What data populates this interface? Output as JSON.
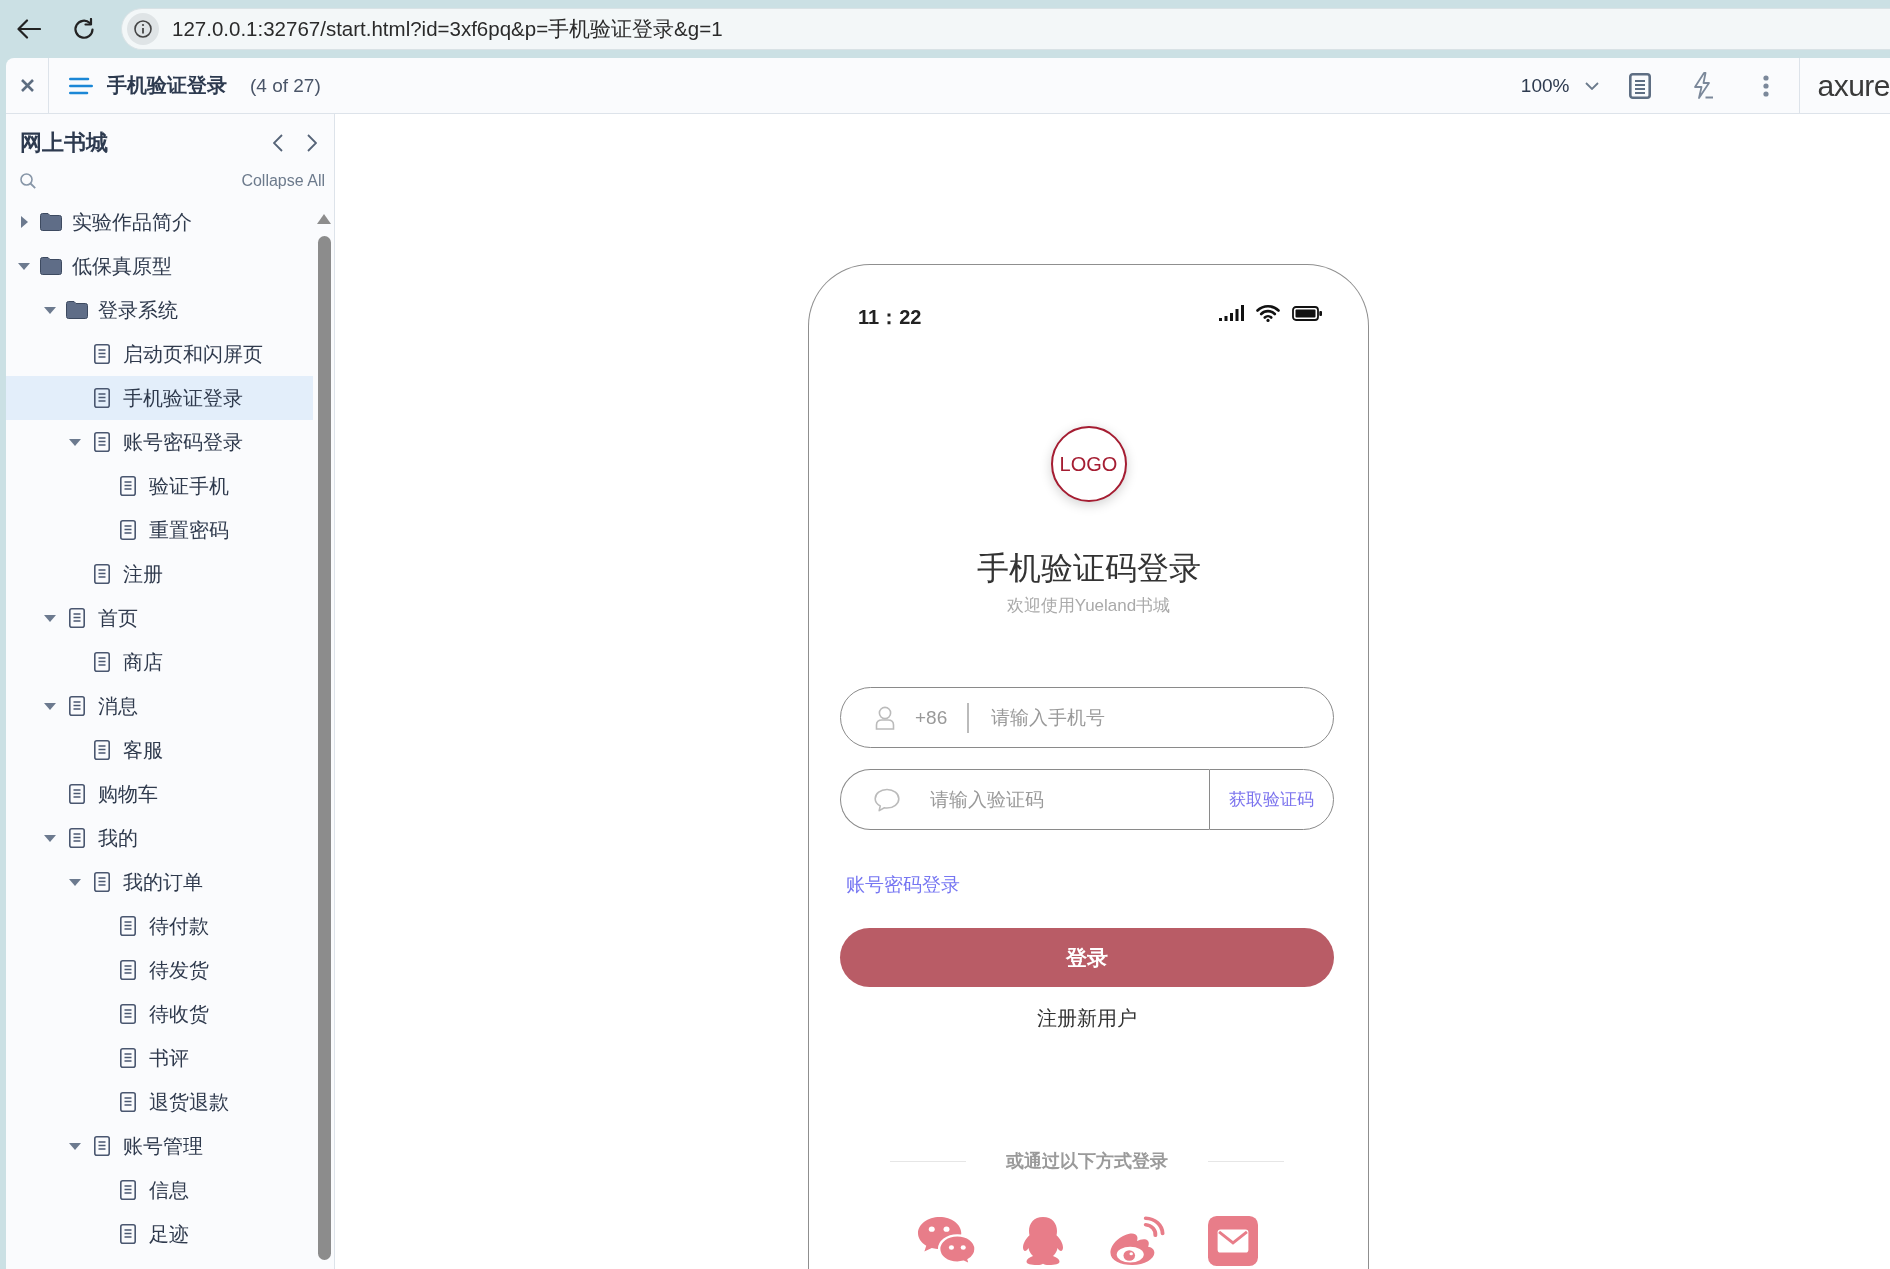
{
  "browser": {
    "url": "127.0.0.1:32767/start.html?id=3xf6pq&p=手机验证登录&g=1"
  },
  "toolbar": {
    "page_title": "手机验证登录",
    "page_position": "(4 of 27)",
    "zoom": "100%",
    "logo": "axure"
  },
  "sidebar": {
    "title": "网上书城",
    "collapse_all": "Collapse All",
    "pages": [
      {
        "label": "实验作品简介",
        "kind": "folder",
        "expanded": false,
        "selected": false
      },
      {
        "label": "低保真原型",
        "kind": "folder",
        "expanded": true,
        "selected": false,
        "children": [
          {
            "label": "登录系统",
            "kind": "folder",
            "expanded": true,
            "selected": false,
            "children": [
              {
                "label": "启动页和闪屏页",
                "kind": "page",
                "selected": false
              },
              {
                "label": "手机验证登录",
                "kind": "page",
                "selected": true
              },
              {
                "label": "账号密码登录",
                "kind": "page",
                "expanded": true,
                "selected": false,
                "children": [
                  {
                    "label": "验证手机",
                    "kind": "page",
                    "selected": false
                  },
                  {
                    "label": "重置密码",
                    "kind": "page",
                    "selected": false
                  }
                ]
              },
              {
                "label": "注册",
                "kind": "page",
                "selected": false
              }
            ]
          },
          {
            "label": "首页",
            "kind": "page",
            "expanded": true,
            "selected": false,
            "children": [
              {
                "label": "商店",
                "kind": "page",
                "selected": false
              }
            ]
          },
          {
            "label": "消息",
            "kind": "page",
            "expanded": true,
            "selected": false,
            "children": [
              {
                "label": "客服",
                "kind": "page",
                "selected": false
              }
            ]
          },
          {
            "label": "购物车",
            "kind": "page",
            "selected": false
          },
          {
            "label": "我的",
            "kind": "page",
            "expanded": true,
            "selected": false,
            "children": [
              {
                "label": "我的订单",
                "kind": "page",
                "expanded": true,
                "selected": false,
                "children": [
                  {
                    "label": "待付款",
                    "kind": "page",
                    "selected": false
                  },
                  {
                    "label": "待发货",
                    "kind": "page",
                    "selected": false
                  },
                  {
                    "label": "待收货",
                    "kind": "page",
                    "selected": false
                  },
                  {
                    "label": "书评",
                    "kind": "page",
                    "selected": false
                  },
                  {
                    "label": "退货退款",
                    "kind": "page",
                    "selected": false
                  }
                ]
              },
              {
                "label": "账号管理",
                "kind": "page",
                "expanded": true,
                "selected": false,
                "children": [
                  {
                    "label": "信息",
                    "kind": "page",
                    "selected": false
                  },
                  {
                    "label": "足迹",
                    "kind": "page",
                    "selected": false
                  }
                ]
              }
            ]
          }
        ]
      }
    ]
  },
  "phone": {
    "time": "11：22",
    "logo": "LOGO",
    "title": "手机验证码登录",
    "subtitle": "欢迎使用Yueland书城",
    "phone_field": {
      "prefix": "+86",
      "placeholder": "请输入手机号"
    },
    "code_field": {
      "placeholder": "请输入验证码"
    },
    "get_code_button": "获取验证码",
    "password_login_link": "账号密码登录",
    "login_button": "登录",
    "register_link": "注册新用户",
    "other_methods_label": "或通过以下方式登录"
  }
}
